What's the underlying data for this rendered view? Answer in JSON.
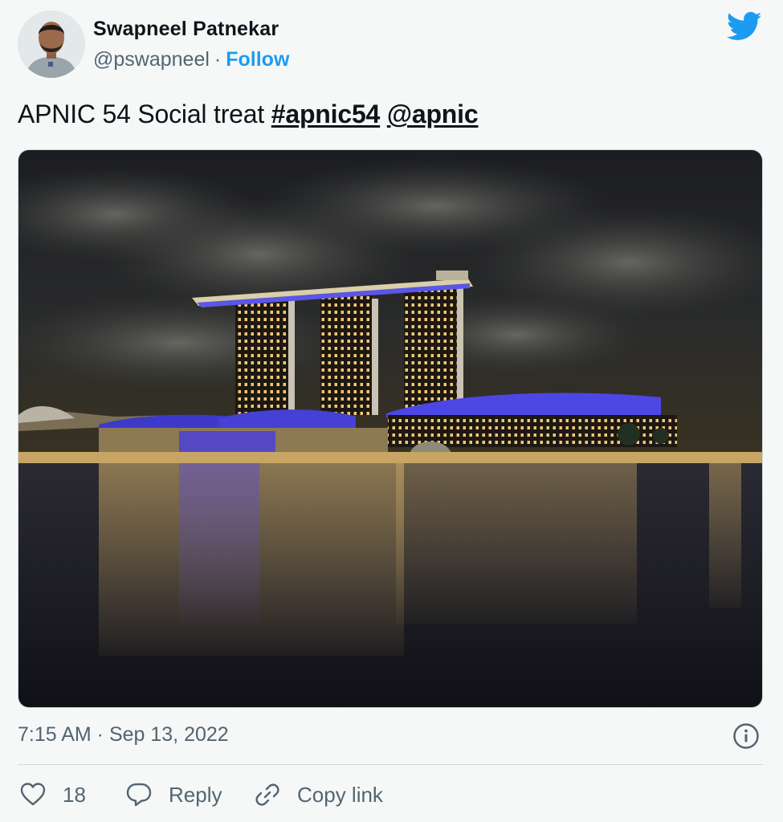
{
  "author": {
    "name": "Swapneel Patnekar",
    "handle": "@pswapneel",
    "separator": "·",
    "follow_label": "Follow"
  },
  "tweet": {
    "text": "APNIC 54 Social treat",
    "hashtag": "#apnic54",
    "mention": "@apnic"
  },
  "meta": {
    "timestamp": "7:15 AM · Sep 13, 2022"
  },
  "actions": {
    "like_count": "18",
    "reply_label": "Reply",
    "copy_label": "Copy link"
  },
  "colors": {
    "accent": "#1d9bf0",
    "muted": "#536471",
    "text": "#0f1419",
    "background": "#f6f8f8"
  },
  "icons": [
    "twitter-bird-icon",
    "info-icon",
    "heart-icon",
    "reply-bubble-icon",
    "link-icon"
  ]
}
